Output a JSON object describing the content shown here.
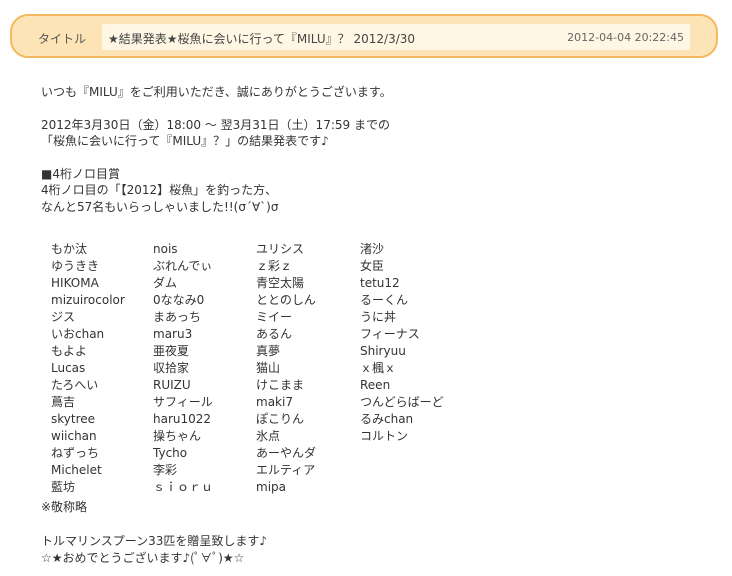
{
  "header": {
    "label": "タイトル",
    "title": "★結果発表★桜魚に会いに行って『MILU』？ 2012/3/30",
    "datetime": "2012-04-04 20:22:45"
  },
  "body": {
    "greeting": "いつも『MILU』をご利用いただき、誠にありがとうございます。",
    "period_line1": "2012年3月30日（金）18:00 ～ 翌3月31日（土）17:59 までの",
    "period_line2": "「桜魚に会いに行って『MILU』？」の結果発表です♪",
    "prize_heading": "■4桁ノロ目賞",
    "prize_line1": "4桁ノロ目の「【2012】桜魚」を釣った方、",
    "prize_line2": "なんと57名もいらっしゃいました!!(σ´∀`)σ"
  },
  "winners": {
    "col0": [
      "もか汰",
      "ゆうきき",
      "HIKOMA",
      "mizuirocolor",
      "ジス",
      "いおchan",
      "もよよ",
      "Lucas",
      "たろへい",
      "蔦吉",
      "skytree",
      "wiichan",
      "ねずっち",
      "Michelet",
      "藍坊"
    ],
    "col1": [
      "nois",
      "ぶれんでぃ",
      "ダム",
      "0ななみ0",
      "まあっち",
      "maru3",
      "亜夜夏",
      "収拾家",
      "RUIZU",
      "サフィール",
      "haru1022",
      "操ちゃん",
      "Tycho",
      "李彩",
      "ｓｉｏｒｕ"
    ],
    "col2": [
      "ユリシス",
      "ｚ彩ｚ",
      "青空太陽",
      "ととのしん",
      "ミイー",
      "あるん",
      "真夢",
      "猫山",
      "けこまま",
      "maki7",
      "ぽこりん",
      "氷点",
      "あーやんダ",
      "エルティア",
      "mipa"
    ],
    "col3": [
      "渚沙",
      "女臣",
      "tetu12",
      "るーくん",
      "うに丼",
      "フィーナス",
      "Shiryuu",
      "ｘ楓ｘ",
      "Reen",
      "つんどらばーど",
      "るみchan",
      "コルトン"
    ]
  },
  "footer": {
    "note": "※敬称略",
    "gift": "トルマリンスプーン33匹を贈呈致します♪",
    "congrats": "☆★おめでとうございます♪(ﾟ∀ﾟ)★☆"
  }
}
